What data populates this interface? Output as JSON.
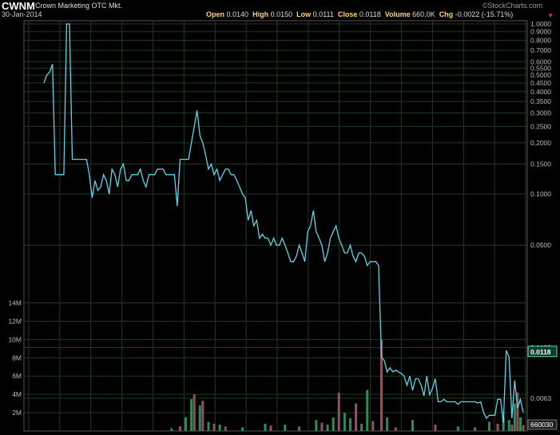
{
  "header": {
    "symbol": "CWNM",
    "company": "Crown Marketing",
    "exchange": "OTC Mkt.",
    "date": "30-Jan-2014",
    "open_label": "Open",
    "open": "0.0140",
    "high_label": "High",
    "high": "0.0150",
    "low_label": "Low",
    "low": "0.0111",
    "close_label": "Close",
    "close": "0.0118",
    "volume_label": "Volume",
    "volume": "660.0K",
    "chg_label": "Chg",
    "chg": "-0.0022 (-15.71%)",
    "brand": "©StockCharts.com",
    "chg_arrow": "▼"
  },
  "colors": {
    "background": "#000000",
    "price_line": "#5cd5e6",
    "grid": "#1f3a1f",
    "volume_up": "#2e8b57",
    "volume_down": "#8b5560",
    "last_price_box": "#0c3e2a"
  },
  "chart_data": [
    {
      "type": "line",
      "yscale": "log",
      "ylim": [
        0.0045,
        1.0
      ],
      "x": [
        0,
        1,
        2,
        3,
        4,
        5,
        6,
        7,
        8,
        9,
        10,
        11,
        12,
        13,
        14,
        15,
        16,
        17,
        18,
        19,
        20,
        21,
        22,
        23,
        24,
        25,
        26,
        27,
        28,
        29,
        30,
        31,
        32,
        33,
        34,
        35,
        36,
        37,
        38,
        39,
        40,
        41,
        42,
        43,
        44,
        45,
        46,
        47,
        48,
        49,
        50,
        51,
        52,
        53,
        54,
        55,
        56,
        57,
        58,
        59,
        60,
        61,
        62,
        63,
        64,
        65,
        66,
        67,
        68,
        69,
        70,
        71,
        72,
        73,
        74,
        75,
        76,
        77,
        78,
        79,
        80,
        81,
        82,
        83,
        84,
        85,
        86,
        87,
        88,
        89,
        90,
        91,
        92,
        93,
        94,
        95,
        96,
        97,
        98,
        99,
        100,
        101,
        102,
        103,
        104,
        105,
        106,
        107,
        108,
        109,
        110,
        111,
        112,
        113,
        114,
        115,
        116,
        117,
        118,
        119,
        120,
        121,
        122,
        123,
        124,
        125,
        126,
        127,
        128,
        129,
        130,
        131,
        132,
        133,
        134,
        135,
        136,
        137,
        138,
        139,
        140,
        141,
        142,
        143,
        144,
        145,
        146,
        147,
        148,
        149,
        150,
        151,
        152,
        153,
        154,
        155,
        156,
        157,
        158,
        159,
        160,
        161,
        162,
        163,
        164,
        165,
        166,
        167,
        168,
        169
      ],
      "y": [
        0.45,
        0.5,
        0.52,
        0.58,
        0.13,
        0.13,
        0.13,
        0.13,
        1.0,
        1.0,
        0.16,
        0.16,
        0.16,
        0.16,
        0.16,
        0.16,
        0.13,
        0.095,
        0.12,
        0.105,
        0.11,
        0.13,
        0.12,
        0.1,
        0.14,
        0.13,
        0.11,
        0.14,
        0.15,
        0.12,
        0.12,
        0.13,
        0.13,
        0.13,
        0.14,
        0.12,
        0.11,
        0.13,
        0.13,
        0.13,
        0.14,
        0.14,
        0.14,
        0.13,
        0.13,
        0.13,
        0.13,
        0.085,
        0.16,
        0.16,
        0.16,
        0.16,
        0.2,
        0.25,
        0.31,
        0.22,
        0.2,
        0.17,
        0.14,
        0.15,
        0.13,
        0.14,
        0.12,
        0.13,
        0.14,
        0.14,
        0.13,
        0.13,
        0.12,
        0.11,
        0.1,
        0.095,
        0.07,
        0.08,
        0.065,
        0.07,
        0.055,
        0.058,
        0.055,
        0.055,
        0.05,
        0.055,
        0.05,
        0.05,
        0.055,
        0.05,
        0.045,
        0.04,
        0.04,
        0.043,
        0.05,
        0.045,
        0.04,
        0.06,
        0.065,
        0.08,
        0.06,
        0.055,
        0.05,
        0.04,
        0.045,
        0.055,
        0.06,
        0.065,
        0.055,
        0.05,
        0.045,
        0.045,
        0.05,
        0.043,
        0.04,
        0.045,
        0.045,
        0.043,
        0.038,
        0.04,
        0.04,
        0.04,
        0.038,
        0.011,
        0.0105,
        0.009,
        0.0095,
        0.009,
        0.0092,
        0.009,
        0.0088,
        0.0085,
        0.0075,
        0.0085,
        0.007,
        0.0082,
        0.0082,
        0.0075,
        0.0065,
        0.0085,
        0.0066,
        0.0072,
        0.0082,
        0.006,
        0.006,
        0.0062,
        0.006,
        0.006,
        0.006,
        0.006,
        0.0058,
        0.006,
        0.006,
        0.006,
        0.006,
        0.006,
        0.006,
        0.0059,
        0.006,
        0.0052,
        0.0048,
        0.005,
        0.005,
        0.005,
        0.0062,
        0.0062,
        0.0045,
        0.012,
        0.011,
        0.0048,
        0.008,
        0.0055,
        0.0062,
        0.0052,
        0.0052,
        0.0062,
        0.0095,
        0.011,
        0.0098,
        0.0118
      ],
      "yticks": [
        "1.0000",
        "0.9000",
        "0.8000",
        "0.7000",
        "0.6000",
        "0.5500",
        "0.5000",
        "0.4500",
        "0.4000",
        "0.3500",
        "0.3000",
        "0.2500",
        "0.2000",
        "0.1500",
        "0.1000",
        "0.0500"
      ],
      "ytick_values": [
        1.0,
        0.9,
        0.8,
        0.7,
        0.6,
        0.55,
        0.5,
        0.45,
        0.4,
        0.35,
        0.3,
        0.25,
        0.2,
        0.15,
        0.1,
        0.05
      ],
      "extra_labels": [
        "0.0125",
        "0.0063"
      ],
      "extra_label_values": [
        0.0125,
        0.0063
      ],
      "last_value_label": "0.0118",
      "last_value": 0.0118
    },
    {
      "type": "bar",
      "ylim": [
        0,
        15000000
      ],
      "yticks": [
        "14M",
        "12M",
        "10M",
        "8M",
        "6M",
        "4M",
        "2M"
      ],
      "ytick_values": [
        14000000,
        12000000,
        10000000,
        8000000,
        6000000,
        4000000,
        2000000
      ],
      "last_value_label": "660030",
      "bars": [
        {
          "x": 45,
          "v": 300000,
          "up": true
        },
        {
          "x": 48,
          "v": 500000,
          "up": false
        },
        {
          "x": 50,
          "v": 1500000,
          "up": true
        },
        {
          "x": 52,
          "v": 3500000,
          "up": true
        },
        {
          "x": 53,
          "v": 4000000,
          "up": false
        },
        {
          "x": 55,
          "v": 2800000,
          "up": true
        },
        {
          "x": 56,
          "v": 3300000,
          "up": false
        },
        {
          "x": 58,
          "v": 1000000,
          "up": true
        },
        {
          "x": 60,
          "v": 800000,
          "up": false
        },
        {
          "x": 62,
          "v": 700000,
          "up": true
        },
        {
          "x": 64,
          "v": 500000,
          "up": false
        },
        {
          "x": 70,
          "v": 400000,
          "up": true
        },
        {
          "x": 78,
          "v": 800000,
          "up": true
        },
        {
          "x": 80,
          "v": 600000,
          "up": false
        },
        {
          "x": 85,
          "v": 700000,
          "up": true
        },
        {
          "x": 90,
          "v": 500000,
          "up": false
        },
        {
          "x": 96,
          "v": 1200000,
          "up": true
        },
        {
          "x": 98,
          "v": 900000,
          "up": false
        },
        {
          "x": 100,
          "v": 700000,
          "up": true
        },
        {
          "x": 102,
          "v": 1500000,
          "up": true
        },
        {
          "x": 104,
          "v": 4200000,
          "up": false
        },
        {
          "x": 106,
          "v": 2000000,
          "up": true
        },
        {
          "x": 108,
          "v": 1400000,
          "up": true
        },
        {
          "x": 110,
          "v": 3000000,
          "up": false
        },
        {
          "x": 112,
          "v": 800000,
          "up": true
        },
        {
          "x": 114,
          "v": 4500000,
          "up": true
        },
        {
          "x": 116,
          "v": 1100000,
          "up": false
        },
        {
          "x": 119,
          "v": 10000000,
          "up": false
        },
        {
          "x": 121,
          "v": 1500000,
          "up": true
        },
        {
          "x": 124,
          "v": 400000,
          "up": false
        },
        {
          "x": 130,
          "v": 1200000,
          "up": true
        },
        {
          "x": 138,
          "v": 700000,
          "up": false
        },
        {
          "x": 146,
          "v": 500000,
          "up": true
        },
        {
          "x": 152,
          "v": 400000,
          "up": false
        },
        {
          "x": 157,
          "v": 1000000,
          "up": true
        },
        {
          "x": 160,
          "v": 800000,
          "up": false
        },
        {
          "x": 162,
          "v": 1500000,
          "up": true
        },
        {
          "x": 164,
          "v": 1200000,
          "up": true
        },
        {
          "x": 165,
          "v": 700000,
          "up": false
        },
        {
          "x": 166,
          "v": 3000000,
          "up": true
        },
        {
          "x": 167,
          "v": 4200000,
          "up": false
        },
        {
          "x": 168,
          "v": 1500000,
          "up": true
        },
        {
          "x": 169,
          "v": 660030,
          "up": false
        }
      ]
    }
  ]
}
